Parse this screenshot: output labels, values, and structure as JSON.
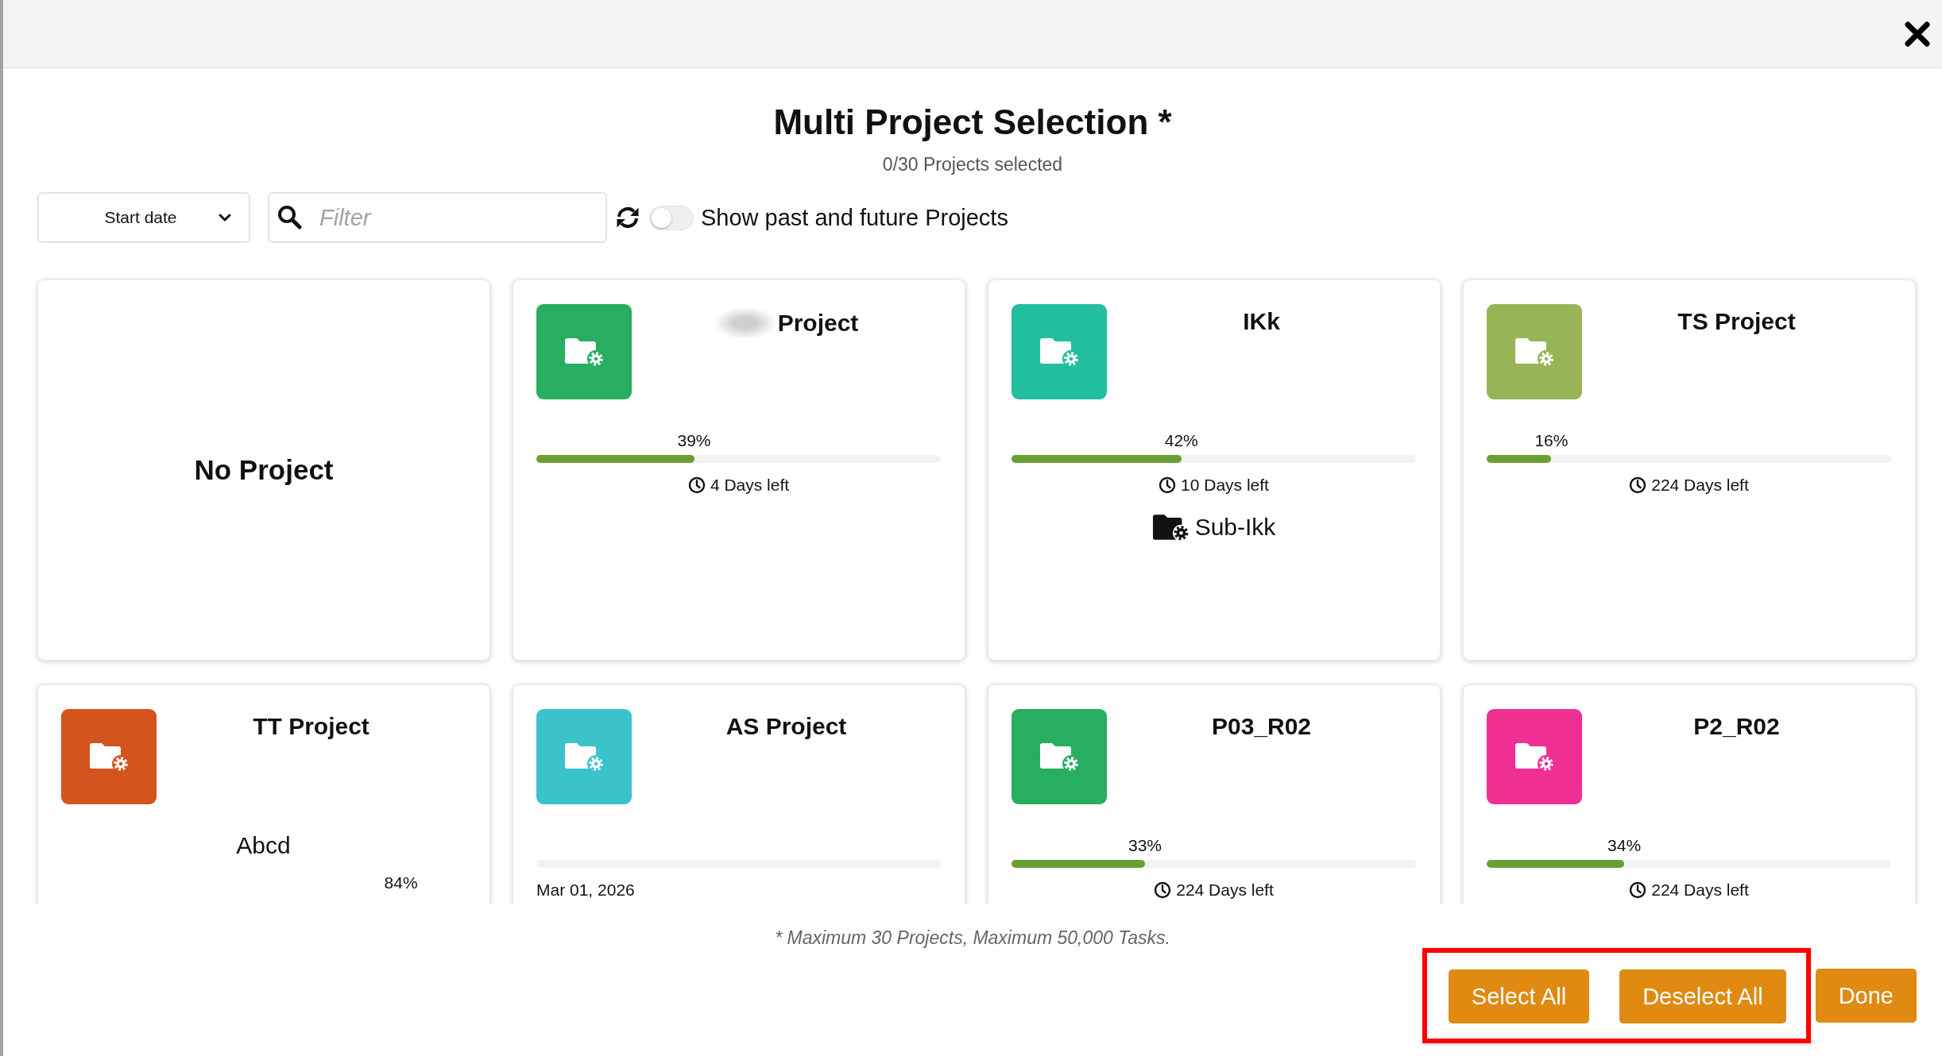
{
  "dialog": {
    "title": "Multi Project Selection *",
    "subtitle": "0/30 Projects selected"
  },
  "toolbar": {
    "sort": {
      "value": "Start date"
    },
    "filter": {
      "placeholder": "Filter"
    },
    "toggle": {
      "label": "Show past and future Projects",
      "on": false
    }
  },
  "projects": [
    {
      "kind": "none",
      "name": "No Project"
    },
    {
      "kind": "project",
      "name": "Project",
      "redacted_prefix": true,
      "color": "#27ae60",
      "lines": [
        {
          "kind": "progress",
          "percent": "39%",
          "level": 0.39
        },
        {
          "kind": "days",
          "text": "4 Days left"
        }
      ]
    },
    {
      "kind": "project",
      "name": "IKk",
      "color": "#22bf9f",
      "lines": [
        {
          "kind": "progress",
          "percent": "42%",
          "level": 0.42
        },
        {
          "kind": "days",
          "text": "10 Days left"
        },
        {
          "kind": "sub_project",
          "text": "Sub-Ikk"
        }
      ]
    },
    {
      "kind": "project",
      "name": "TS Project",
      "color": "#97b556",
      "lines": [
        {
          "kind": "progress",
          "percent": "16%",
          "level": 0.16
        },
        {
          "kind": "days",
          "text": "224 Days left"
        }
      ]
    },
    {
      "kind": "project",
      "name": "TT Project",
      "color": "#d4541e",
      "lines": [
        {
          "kind": "description",
          "text": "Abcd"
        },
        {
          "kind": "percent",
          "percent": "84%",
          "level": 0.84
        }
      ]
    },
    {
      "kind": "project",
      "name": "AS Project",
      "color": "#3bc3cc",
      "lines": [
        {
          "kind": "empty_bar"
        },
        {
          "kind": "date",
          "text": "Mar 01, 2026"
        }
      ]
    },
    {
      "kind": "project",
      "name": "P03_R02",
      "color": "#27ae60",
      "lines": [
        {
          "kind": "progress",
          "percent": "33%",
          "level": 0.33
        },
        {
          "kind": "days",
          "text": "224 Days left"
        }
      ]
    },
    {
      "kind": "project",
      "name": "P2_R02",
      "color": "#f02f92",
      "lines": [
        {
          "kind": "progress",
          "percent": "34%",
          "level": 0.34
        },
        {
          "kind": "days",
          "text": "224 Days left"
        }
      ]
    }
  ],
  "footer": {
    "note": "* Maximum 30 Projects, Maximum 50,000 Tasks.",
    "buttons": [
      {
        "label": "Select All",
        "highlighted": true
      },
      {
        "label": "Deselect All",
        "highlighted": true
      },
      {
        "label": "Done",
        "highlighted": false
      }
    ]
  }
}
